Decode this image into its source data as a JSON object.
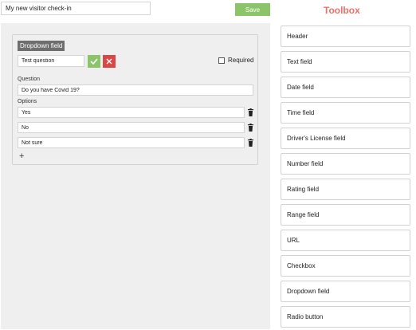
{
  "form": {
    "name": "My new visitor check-in",
    "save_label": "Save"
  },
  "toolbox": {
    "title": "Toolbox",
    "items": [
      {
        "label": "Header"
      },
      {
        "label": "Text field"
      },
      {
        "label": "Date field"
      },
      {
        "label": "Time field"
      },
      {
        "label": "Driver's License field"
      },
      {
        "label": "Number field"
      },
      {
        "label": "Rating field"
      },
      {
        "label": "Range field"
      },
      {
        "label": "URL"
      },
      {
        "label": "Checkbox"
      },
      {
        "label": "Dropdown field"
      },
      {
        "label": "Radio button"
      }
    ]
  },
  "field": {
    "type": "Dropdown field",
    "label_value": "Test question",
    "required_label": "Required",
    "required": false,
    "question_label": "Question",
    "question_value": "Do you have Covid 19?",
    "options_label": "Options",
    "options": [
      {
        "value": "Yes"
      },
      {
        "value": "No"
      },
      {
        "value": "Not sure"
      }
    ],
    "add_label": "+"
  },
  "colors": {
    "accent_green": "#8cc46a",
    "danger_red": "#d94747",
    "toolbox_title": "#ed7066",
    "badge_gray": "#6e6e6e"
  },
  "icons": {
    "confirm": "check-icon",
    "cancel": "close-icon",
    "delete": "trash-icon",
    "add": "plus-icon"
  }
}
